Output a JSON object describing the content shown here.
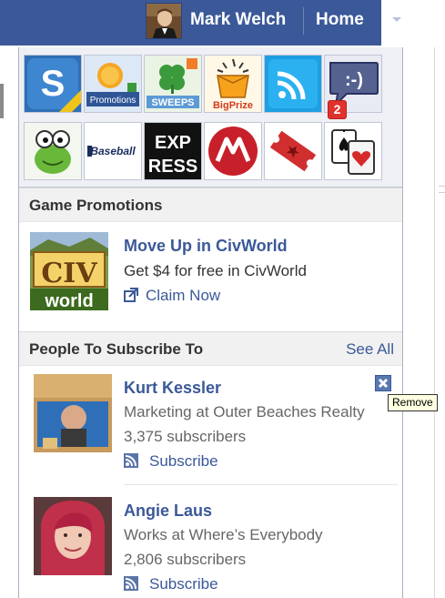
{
  "header": {
    "user_name": "Mark Welch",
    "home_label": "Home"
  },
  "apps": {
    "notification_count": "2",
    "tiles": [
      {
        "name": "S Free",
        "icon": "s-free-app-icon"
      },
      {
        "name": "Promotions",
        "icon": "promotions-app-icon",
        "label": "Promotions"
      },
      {
        "name": "Sweeps",
        "icon": "sweeps-clover-app-icon",
        "label": "SWEEPS"
      },
      {
        "name": "BigPrize",
        "icon": "bigprize-app-icon",
        "label": "BigPrize"
      },
      {
        "name": "Wifi",
        "icon": "wifi-app-icon"
      },
      {
        "name": "Chat",
        "icon": "smiley-chat-app-icon",
        "label": ":-)"
      },
      {
        "name": "Frog",
        "icon": "frog-app-icon"
      },
      {
        "name": "Baseball",
        "icon": "baseball-app-icon",
        "label": "Baseball"
      },
      {
        "name": "Express",
        "icon": "express-app-icon",
        "label": "EXPRESS"
      },
      {
        "name": "M",
        "icon": "m-logo-app-icon"
      },
      {
        "name": "Ticket",
        "icon": "ticket-app-icon"
      },
      {
        "name": "Cards",
        "icon": "playing-cards-app-icon"
      }
    ]
  },
  "game_promotions": {
    "heading": "Game Promotions",
    "item": {
      "title": "Move Up in CivWorld",
      "description": "Get $4 for free in CivWorld",
      "action": "Claim Now",
      "thumb_text_top": "CIV",
      "thumb_text_bottom": "world"
    }
  },
  "subscribe": {
    "heading": "People To Subscribe To",
    "see_all": "See All",
    "people": [
      {
        "name": "Kurt Kessler",
        "subtitle": "Marketing at Outer Beaches Realty",
        "subscribers": "3,375 subscribers",
        "action": "Subscribe"
      },
      {
        "name": "Angie Laus",
        "subtitle": "Works at Where’s Everybody",
        "subscribers": "2,806 subscribers",
        "action": "Subscribe"
      }
    ],
    "remove_tooltip": "Remove"
  },
  "colors": {
    "facebook_blue": "#3b5998",
    "badge_red": "#e0322d",
    "tooltip_bg": "#ffffe1"
  }
}
